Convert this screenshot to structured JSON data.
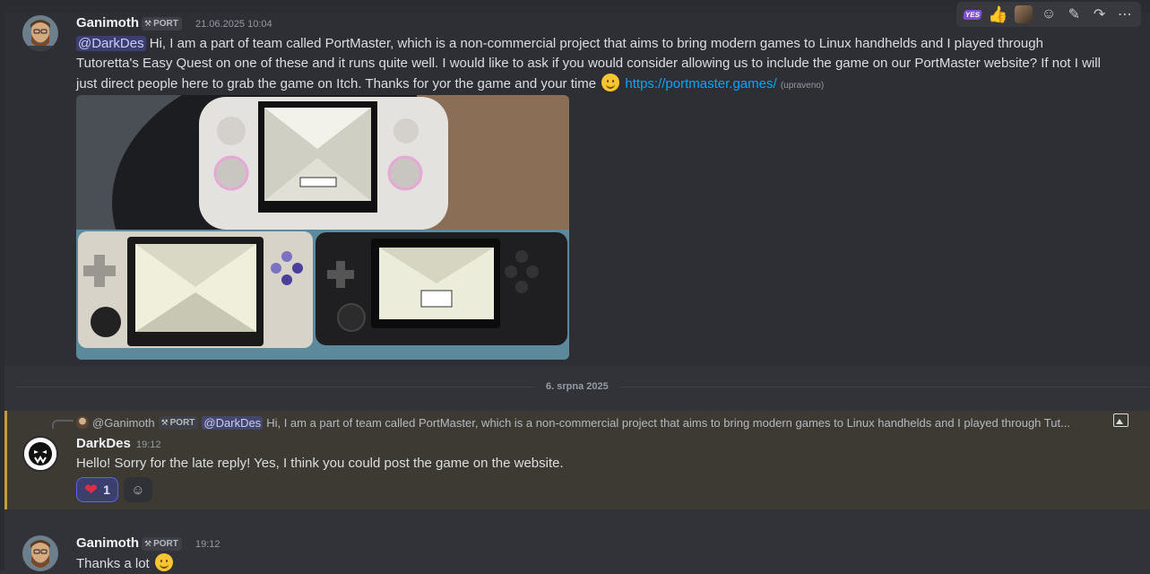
{
  "toolbar": {
    "yes_label": "YES",
    "thumb": "👍",
    "icons": [
      "add-reaction-icon",
      "edit-icon",
      "forward-icon",
      "more-icon"
    ],
    "reaction_glyph": "☺",
    "edit_glyph": "✎",
    "forward_glyph": "↷",
    "more_glyph": "⋯"
  },
  "messages": [
    {
      "author": "Ganimoth",
      "tag": "PORT",
      "timestamp": "21.06.2025 10:04",
      "mention": "@DarkDes",
      "text_1": " Hi, I am a part of team called PortMaster, which is a non-commercial project that aims to bring modern games to Linux handhelds and I played through",
      "text_2": "Tutoretta's Easy Quest on one of these and it runs quite well. I would like to ask if you would consider allowing us to include the game on our PortMaster website? If not I will",
      "text_3": "just direct people here to grab the game on Itch. Thanks for yor the game and your time",
      "link": "https://portmaster.games/",
      "edited": "(upraveno)"
    },
    {
      "author": "DarkDes",
      "timestamp": "19:12",
      "text": "Hello! Sorry for the late reply!  Yes, I think you could post the game on the website.",
      "reply": {
        "author": "@Ganimoth",
        "tag": "PORT",
        "mention": "@DarkDes",
        "snippet": "Hi, I am a part of team called PortMaster, which is a non-commercial project that aims to bring modern games to Linux handhelds and I played through Tut..."
      },
      "reactions": [
        {
          "emoji": "❤",
          "count": "1"
        }
      ]
    },
    {
      "author": "Ganimoth",
      "tag": "PORT",
      "timestamp": "19:12",
      "text": "Thanks a lot"
    }
  ],
  "divider": {
    "date": "6. srpna 2025"
  },
  "colors": {
    "background": "#323339",
    "mention_bg": "#3c4270",
    "link": "#00a8fc",
    "reply_highlight": "#3d3a33",
    "reply_bar": "#c59d3a",
    "reaction_active_border": "#5865f2"
  }
}
